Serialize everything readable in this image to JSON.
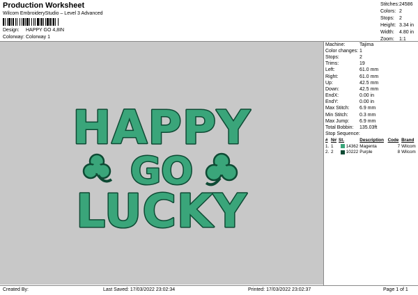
{
  "header": {
    "title": "Production Worksheet",
    "subtitle": "Wilcom EmbroideryStudio – Level 3 Advanced",
    "design_label": "Design:",
    "design_value": "HAPPY GO 4,8IN",
    "colorway_label": "Colorway:",
    "colorway_value": "Colorway 1"
  },
  "stats": [
    {
      "label": "Stitches:",
      "value": "24586"
    },
    {
      "label": "Colors:",
      "value": "2"
    },
    {
      "label": "Stops:",
      "value": "2"
    },
    {
      "label": "Height:",
      "value": "3.34 in"
    },
    {
      "label": "Width:",
      "value": "4.80 in"
    },
    {
      "label": "Zoom:",
      "value": "1:1"
    }
  ],
  "design_text": {
    "line1": "HAPPY",
    "line2": "GO",
    "line3": "LUCKY"
  },
  "machine_info": [
    {
      "label": "Machine:",
      "value": "Tajima"
    },
    {
      "label": "Color changes:",
      "value": "1"
    },
    {
      "label": "Stops:",
      "value": "2"
    },
    {
      "label": "Trims:",
      "value": "19"
    },
    {
      "label": "Left:",
      "value": "61.0 mm"
    },
    {
      "label": "Right:",
      "value": "61.0 mm"
    },
    {
      "label": "Up:",
      "value": "42.5 mm"
    },
    {
      "label": "Down:",
      "value": "42.5 mm"
    },
    {
      "label": "EndX:",
      "value": "0.00 in"
    },
    {
      "label": "EndY:",
      "value": "0.00 in"
    },
    {
      "label": "Max Stitch:",
      "value": "6.9 mm"
    },
    {
      "label": "Min Stitch:",
      "value": "0.3 mm"
    },
    {
      "label": "Max Jump:",
      "value": "6.9 mm"
    },
    {
      "label": "Total Bobbin:",
      "value": "135.03ft"
    }
  ],
  "stop_sequence": {
    "title": "Stop Sequence:",
    "headers": [
      "#",
      "N#",
      "St.",
      "Description",
      "Code",
      "Brand"
    ],
    "rows": [
      {
        "num": "1.",
        "n": "1",
        "swatch": "#3aa57a",
        "st": "14362",
        "description": "Magenta",
        "code": "7",
        "brand": "Wilcom"
      },
      {
        "num": "2.",
        "n": "2",
        "swatch": "#0e4a34",
        "st": "10222",
        "description": "Purple",
        "code": "8",
        "brand": "Wilcom"
      }
    ]
  },
  "footer": {
    "created_by": "Created By:",
    "last_saved": "Last Saved: 17/03/2022 23:02:34",
    "printed": "Printed: 17/03/2022 23:02:37",
    "page": "Page 1 of 1"
  },
  "colors": {
    "canvas_bg": "#c8c8c8",
    "fill_green": "#3aa57a",
    "outline_green": "#0e4a34"
  }
}
